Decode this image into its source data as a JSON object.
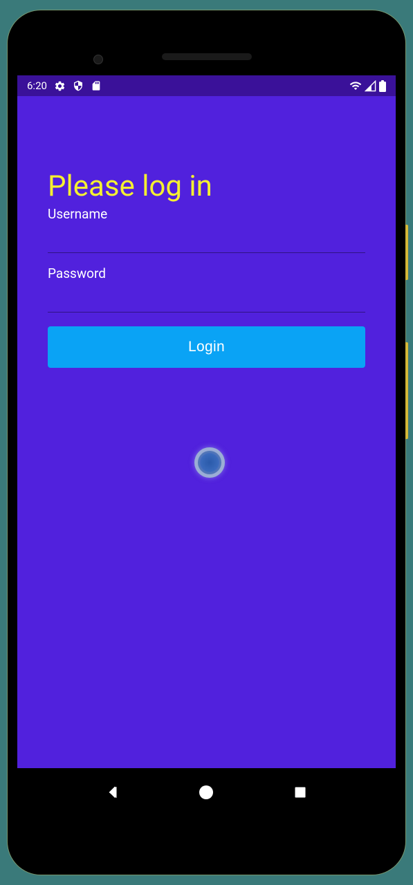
{
  "status_bar": {
    "time": "6:20"
  },
  "content": {
    "title": "Please log in",
    "username_label": "Username",
    "username_value": "",
    "password_label": "Password",
    "password_value": "",
    "login_button_label": "Login"
  }
}
